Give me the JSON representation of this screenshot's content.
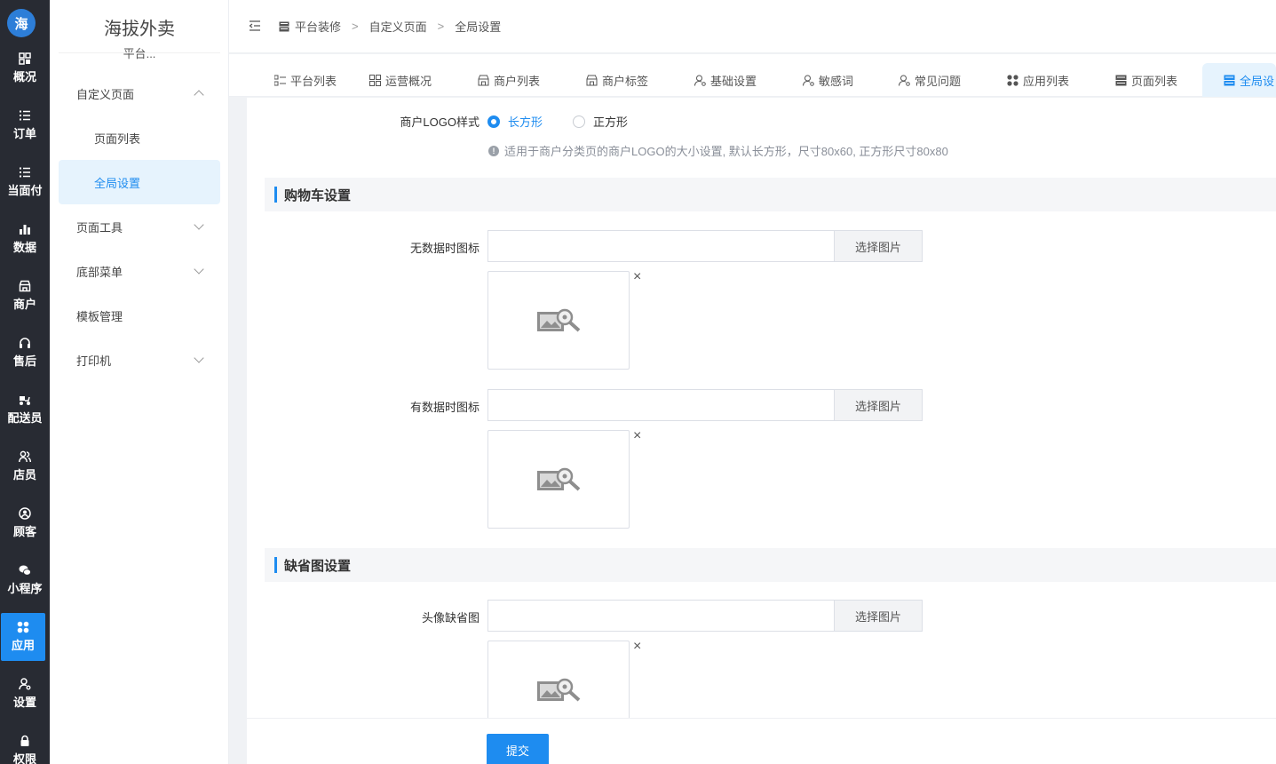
{
  "nav": {
    "logo": "海",
    "items": [
      {
        "label": "概况",
        "icon": "dashboard-icon"
      },
      {
        "label": "订单",
        "icon": "list-icon"
      },
      {
        "label": "当面付",
        "icon": "list-icon"
      },
      {
        "label": "数据",
        "icon": "bar-chart-icon"
      },
      {
        "label": "商户",
        "icon": "store-icon"
      },
      {
        "label": "售后",
        "icon": "headset-icon"
      },
      {
        "label": "配送员",
        "icon": "scooter-icon"
      },
      {
        "label": "店员",
        "icon": "staff-icon"
      },
      {
        "label": "顾客",
        "icon": "customer-icon"
      },
      {
        "label": "小程序",
        "icon": "wechat-icon"
      },
      {
        "label": "应用",
        "icon": "apps-icon"
      },
      {
        "label": "设置",
        "icon": "user-settings-icon"
      },
      {
        "label": "权限",
        "icon": "lock-icon"
      }
    ],
    "active": "应用"
  },
  "sidebar": {
    "title": "海拔外卖",
    "subtitle": "平台...",
    "menu": [
      {
        "label": "自定义页面",
        "expanded": true
      },
      {
        "label": "页面列表"
      },
      {
        "label": "全局设置",
        "active": true
      },
      {
        "label": "页面工具"
      },
      {
        "label": "底部菜单"
      },
      {
        "label": "模板管理"
      },
      {
        "label": "打印机"
      }
    ]
  },
  "breadcrumb": [
    "平台装修",
    "自定义页面",
    "全局设置"
  ],
  "tabs": [
    {
      "label": "平台列表"
    },
    {
      "label": "运营概况"
    },
    {
      "label": "商户列表"
    },
    {
      "label": "商户标签"
    },
    {
      "label": "基础设置"
    },
    {
      "label": "敏感词"
    },
    {
      "label": "常见问题"
    },
    {
      "label": "应用列表"
    },
    {
      "label": "页面列表"
    },
    {
      "label": "全局设",
      "active": true
    }
  ],
  "form": {
    "logo_style": {
      "label": "商户LOGO样式",
      "options": [
        "长方形",
        "正方形"
      ],
      "selected": "长方形",
      "hint": "适用于商户分类页的商户LOGO的大小设置, 默认长方形，尺寸80x60, 正方形尺寸80x80"
    },
    "cart_section": {
      "title": "购物车设置",
      "empty_icon": {
        "label": "无数据时图标",
        "value": "",
        "button": "选择图片"
      },
      "data_icon": {
        "label": "有数据时图标",
        "value": "",
        "button": "选择图片"
      }
    },
    "default_section": {
      "title": "缺省图设置",
      "avatar": {
        "label": "头像缺省图",
        "value": "",
        "button": "选择图片"
      }
    },
    "close_glyph": "×",
    "hint_glyph": "!",
    "submit": "提交"
  },
  "colors": {
    "accent": "#1e8cf0",
    "nav_bg": "#282b33"
  }
}
